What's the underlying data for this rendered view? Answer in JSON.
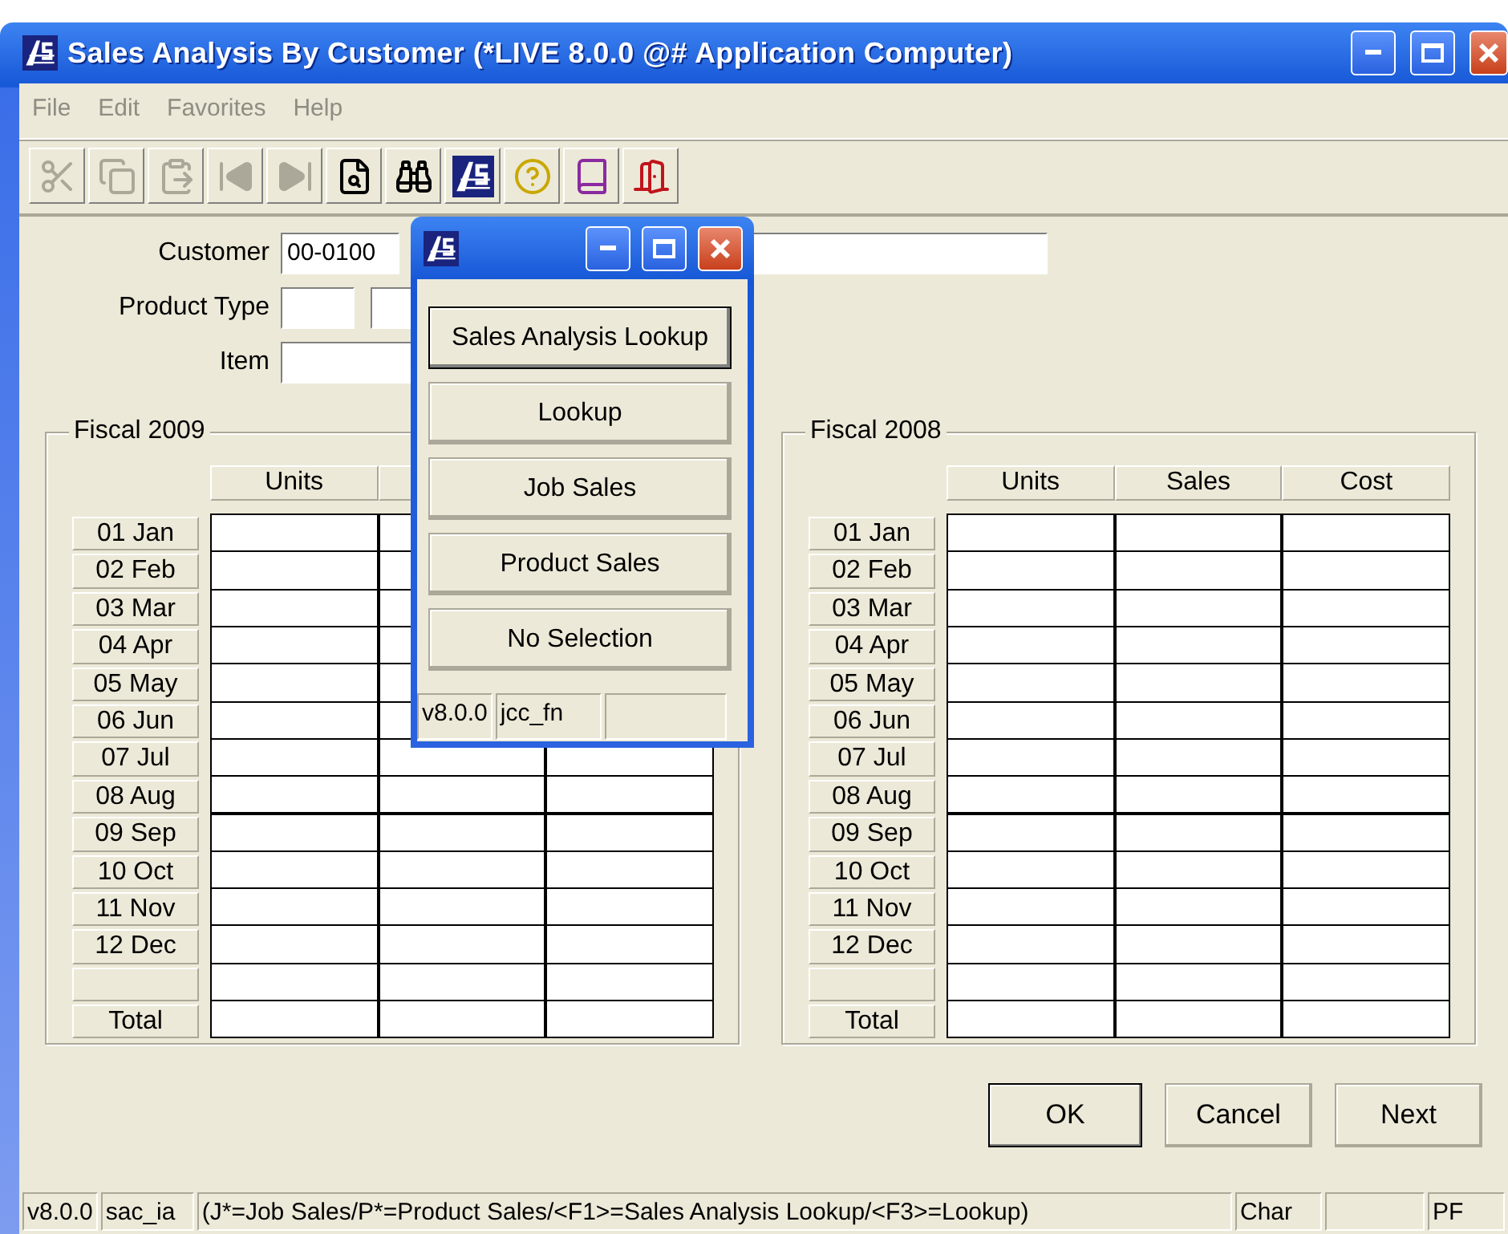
{
  "window": {
    "title": "Sales Analysis By Customer (*LIVE 8.0.0 @# Application Computer)"
  },
  "menu": [
    "File",
    "Edit",
    "Favorites",
    "Help"
  ],
  "toolbar": [
    {
      "kind": "cut",
      "disabled": true
    },
    {
      "kind": "copy",
      "disabled": true
    },
    {
      "kind": "paste",
      "disabled": true
    },
    {
      "kind": "first",
      "disabled": true
    },
    {
      "kind": "last",
      "disabled": true
    },
    {
      "kind": "search",
      "disabled": false
    },
    {
      "kind": "find",
      "disabled": false
    },
    {
      "kind": "logo",
      "disabled": false
    },
    {
      "kind": "help",
      "disabled": false
    },
    {
      "kind": "book",
      "disabled": false
    },
    {
      "kind": "exit",
      "disabled": false
    }
  ],
  "form": {
    "customer_label": "Customer",
    "customer_value": "00-0100",
    "product_type_label": "Product Type",
    "item_label": "Item"
  },
  "fiscal_groups": [
    {
      "title": "Fiscal 2009",
      "columns": [
        "Units"
      ],
      "rows": [
        "01 Jan",
        "02 Feb",
        "03 Mar",
        "04 Apr",
        "05 May",
        "06 Jun",
        "07 Jul",
        "08 Aug",
        "09 Sep",
        "10 Oct",
        "11 Nov",
        "12 Dec"
      ],
      "total": "Total"
    },
    {
      "title": "Fiscal 2008",
      "columns": [
        "Units",
        "Sales",
        "Cost"
      ],
      "rows": [
        "01 Jan",
        "02 Feb",
        "03 Mar",
        "04 Apr",
        "05 May",
        "06 Jun",
        "07 Jul",
        "08 Aug",
        "09 Sep",
        "10 Oct",
        "11 Nov",
        "12 Dec"
      ],
      "total": "Total"
    }
  ],
  "buttons": [
    {
      "label": "OK",
      "default": true
    },
    {
      "label": "Cancel",
      "default": false
    },
    {
      "label": "Next",
      "default": false
    }
  ],
  "status_bar": {
    "version": "v8.0.0",
    "program": "sac_ia",
    "message": "(J*=Job Sales/P*=Product Sales/<F1>=Sales Analysis Lookup/<F3>=Lookup)",
    "mode": "Char",
    "keys": "PF"
  },
  "popup": {
    "buttons": [
      {
        "label": "Sales Analysis Lookup",
        "default": true
      },
      {
        "label": "Lookup",
        "default": false
      },
      {
        "label": "Job Sales",
        "default": false
      },
      {
        "label": "Product Sales",
        "default": false
      },
      {
        "label": "No Selection",
        "default": false
      }
    ],
    "status_bar": {
      "version": "v8.0.0",
      "program": "jcc_fn"
    }
  }
}
